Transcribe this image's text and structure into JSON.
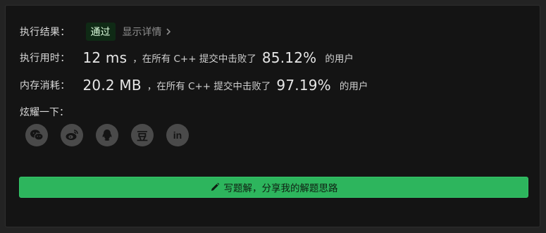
{
  "result": {
    "label": "执行结果：",
    "status": "通过",
    "details_link": "显示详情"
  },
  "runtime": {
    "label": "执行用时：",
    "value": "12 ms",
    "prefix": "，在所有 C++ 提交中击败了",
    "percent": "85.12%",
    "suffix": "的用户"
  },
  "memory": {
    "label": "内存消耗：",
    "value": "20.2 MB",
    "prefix": "，在所有 C++ 提交中击败了",
    "percent": "97.19%",
    "suffix": "的用户"
  },
  "share": {
    "label": "炫耀一下：",
    "icons": [
      "wechat-icon",
      "weibo-icon",
      "qq-icon",
      "douban-icon",
      "linkedin-icon"
    ],
    "douban_glyph": "豆",
    "linkedin_glyph": "in"
  },
  "write_button": {
    "label": "写题解，分享我的解题思路",
    "icon": "pencil-icon"
  },
  "colors": {
    "background": "#141414",
    "accent_green": "#2db55d",
    "badge_bg": "#0f2a15",
    "icon_circle": "#4a4a4a"
  }
}
